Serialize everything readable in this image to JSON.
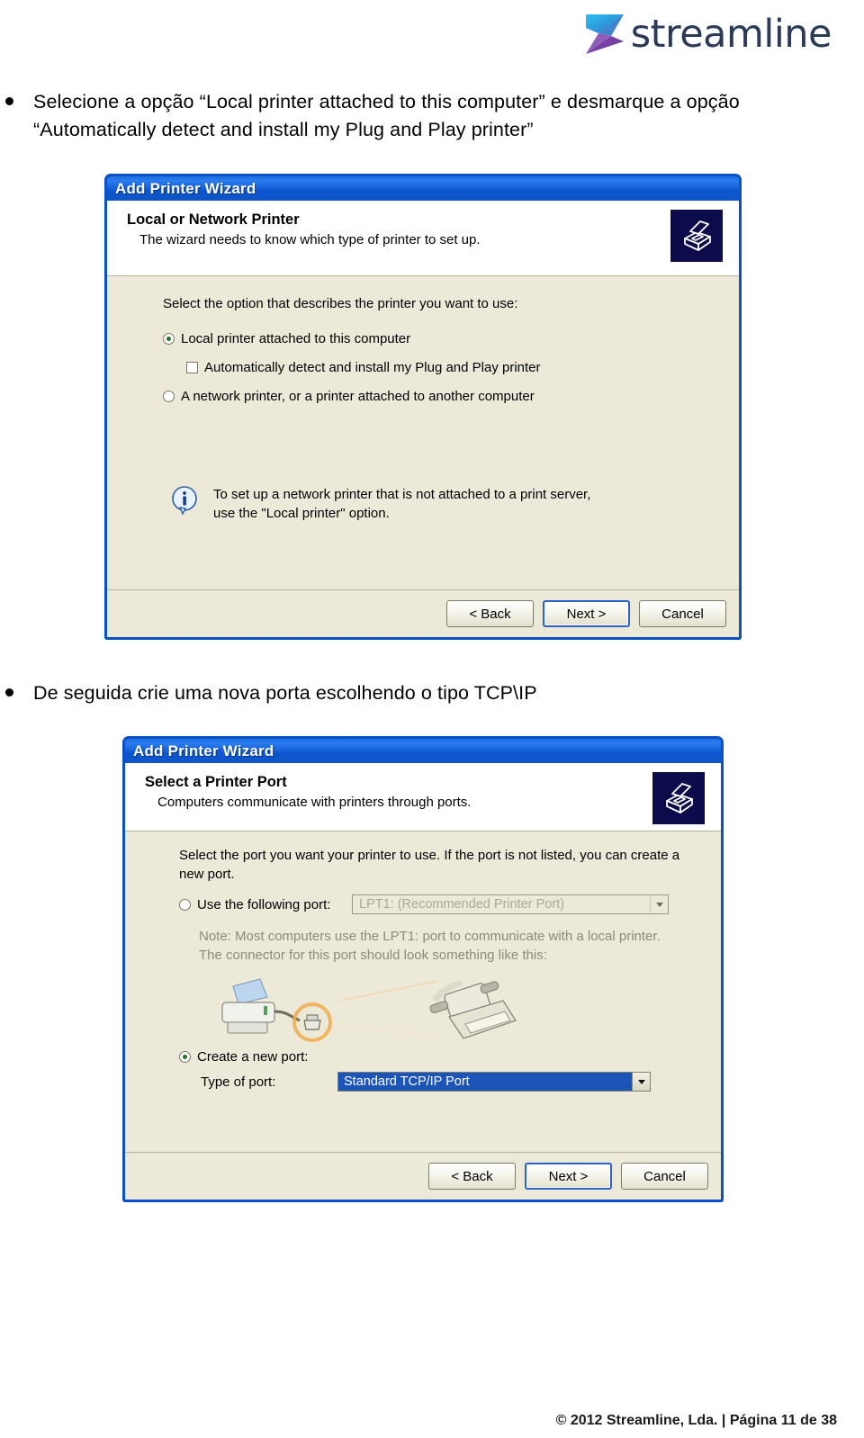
{
  "brand": {
    "name": "streamline",
    "logo_icon": "streamline-arrow-logo",
    "colors": {
      "blue": "#2fa8e0",
      "purple": "#8e3fa8",
      "text": "#2b3a57"
    }
  },
  "instructions": [
    {
      "bullet_icon": "bullet-dot",
      "text": "Selecione a opção “Local printer attached to this computer” e desmarque a opção “Automatically detect and install my Plug and Play printer”"
    },
    {
      "bullet_icon": "bullet-dot",
      "text": "De seguida crie uma nova porta escolhendo o tipo TCP\\IP"
    }
  ],
  "dialog_1": {
    "window_title": "Add Printer Wizard",
    "header": {
      "title": "Local or Network Printer",
      "subtitle": "The wizard needs to know which type of printer to set up.",
      "icon": "printer-icon"
    },
    "prompt": "Select the option that describes the printer you want to use:",
    "options": [
      {
        "label": "Local printer attached to this computer",
        "type": "radio",
        "checked": true
      },
      {
        "label": "Automatically detect and install my Plug and Play printer",
        "type": "checkbox",
        "checked": false
      },
      {
        "label": "A network printer, or a printer attached to another computer",
        "type": "radio",
        "checked": false
      }
    ],
    "info": {
      "icon": "info-icon",
      "line1": "To set up a network printer that is not attached to a print server,",
      "line2": "use the \"Local printer\" option."
    },
    "buttons": [
      {
        "label": "< Back",
        "default": false
      },
      {
        "label": "Next >",
        "default": true
      },
      {
        "label": "Cancel",
        "default": false
      }
    ]
  },
  "dialog_2": {
    "window_title": "Add Printer Wizard",
    "header": {
      "title": "Select a Printer Port",
      "subtitle": "Computers communicate with printers through ports.",
      "icon": "printer-icon"
    },
    "prompt_line1": "Select the port you want your printer to use.  If the port is not listed, you can create a",
    "prompt_line2": "new port.",
    "use_existing": {
      "label": "Use the following port:",
      "checked": false,
      "value": "LPT1: (Recommended Printer Port)",
      "enabled": false
    },
    "note_line1": "Note: Most computers use the LPT1: port to communicate with a local printer.",
    "note_line2": "The connector for this port should look something like this:",
    "illustration_icon": "printer-parallel-cable-illustration",
    "create_new": {
      "label": "Create a new port:",
      "checked": true,
      "type_label": "Type of port:",
      "value": "Standard TCP/IP Port",
      "enabled": true
    },
    "buttons": [
      {
        "label": "< Back",
        "default": false
      },
      {
        "label": "Next >",
        "default": true
      },
      {
        "label": "Cancel",
        "default": false
      }
    ]
  },
  "page_footer": "© 2012 Streamline, Lda. | Página  11 de 38"
}
